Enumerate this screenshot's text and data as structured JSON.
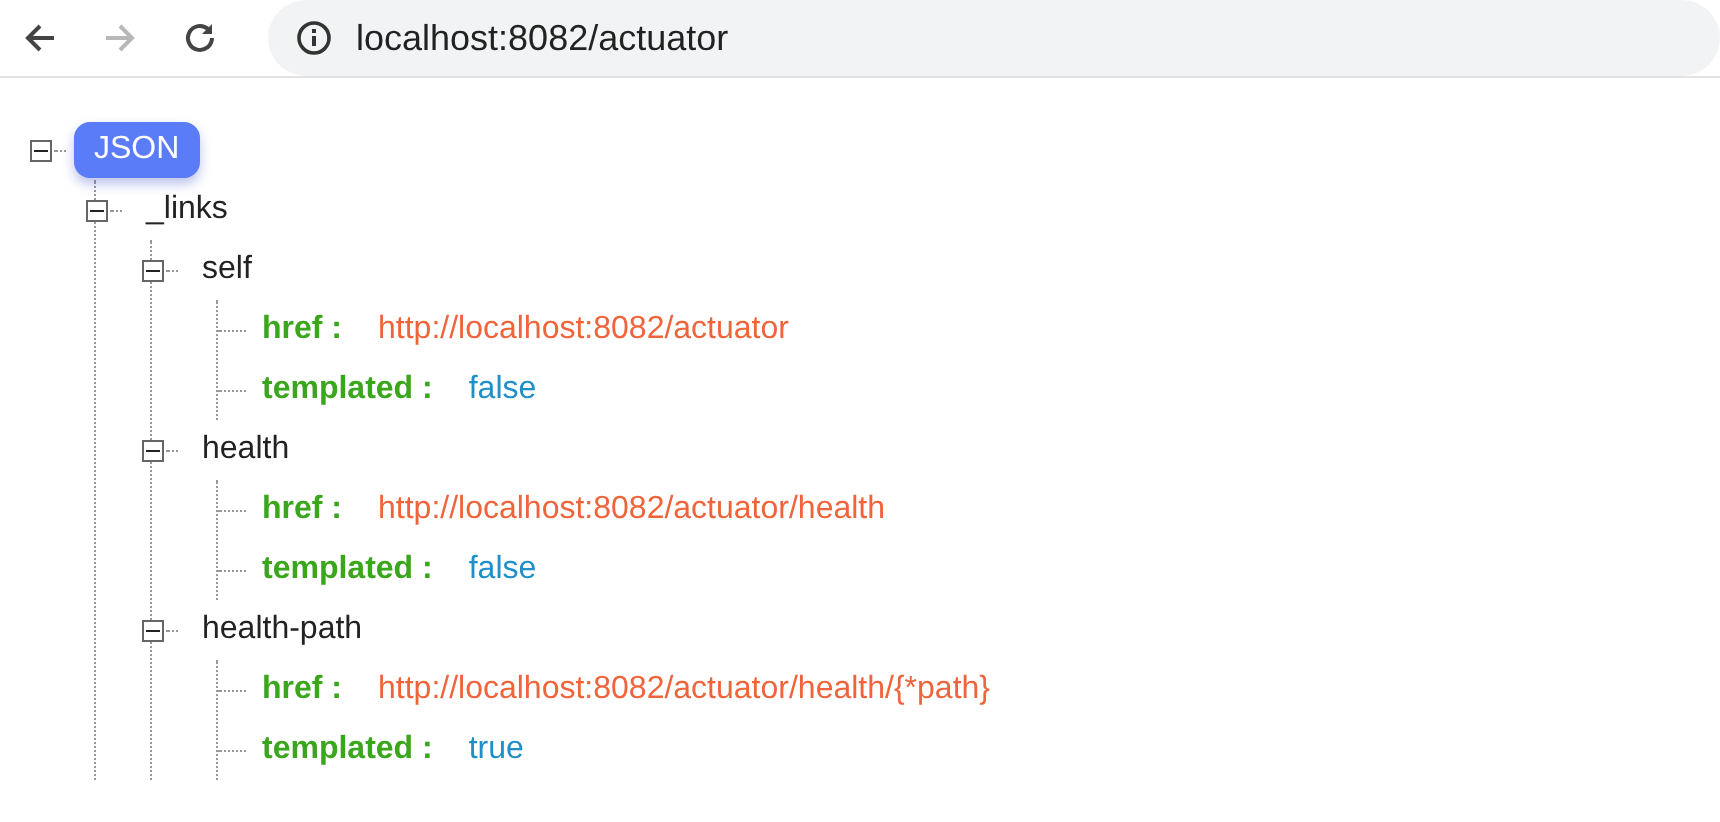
{
  "browser": {
    "back_disabled": false,
    "forward_disabled": true,
    "address": "localhost:8082/actuator"
  },
  "tree": {
    "label": "JSON",
    "expanded": true,
    "children": [
      {
        "label": "_links",
        "expanded": true,
        "children": [
          {
            "label": "self",
            "expanded": true,
            "fields": [
              {
                "key": "href :",
                "value": "http://localhost:8082/actuator",
                "kind": "string"
              },
              {
                "key": "templated :",
                "value": "false",
                "kind": "boolean"
              }
            ]
          },
          {
            "label": "health",
            "expanded": true,
            "fields": [
              {
                "key": "href :",
                "value": "http://localhost:8082/actuator/health",
                "kind": "string"
              },
              {
                "key": "templated :",
                "value": "false",
                "kind": "boolean"
              }
            ]
          },
          {
            "label": "health-path",
            "expanded": true,
            "fields": [
              {
                "key": "href :",
                "value": "http://localhost:8082/actuator/health/{*path}",
                "kind": "string"
              },
              {
                "key": "templated :",
                "value": "true",
                "kind": "boolean"
              }
            ]
          }
        ]
      }
    ]
  }
}
